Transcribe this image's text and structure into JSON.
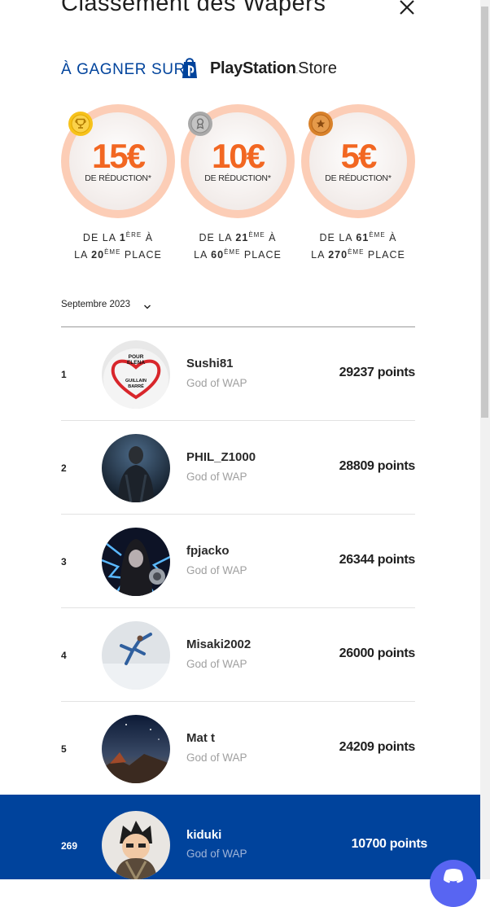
{
  "header": {
    "title": "Classement des Wapers",
    "close_icon": "close-icon"
  },
  "prizes": {
    "heading": "À GAGNER SUR",
    "store_brand": "PlayStation",
    "store_word": "Store",
    "logo_icon": "playstation-logo-icon",
    "items": [
      {
        "amount": "15€",
        "label": "DE RÉDUCTION*",
        "line1_pre": "DE LA ",
        "line1_num": "1",
        "line1_sup": "ÈRE",
        "line1_post": " À",
        "line2_pre": "LA ",
        "line2_num": "20",
        "line2_sup": "ÈME",
        "line2_post": " PLACE",
        "medal": "gold-trophy-icon",
        "medal_color": "#f7c21b"
      },
      {
        "amount": "10€",
        "label": "DE RÉDUCTION*",
        "line1_pre": "DE LA ",
        "line1_num": "21",
        "line1_sup": "ÈME",
        "line1_post": " À",
        "line2_pre": "LA ",
        "line2_num": "60",
        "line2_sup": "ÈME",
        "line2_post": " PLACE",
        "medal": "silver-medal-icon",
        "medal_color": "#a9a9a9"
      },
      {
        "amount": "5€",
        "label": "DE RÉDUCTION*",
        "line1_pre": "DE LA ",
        "line1_num": "61",
        "line1_sup": "ÈME",
        "line1_post": " À",
        "line2_pre": "LA ",
        "line2_num": "270",
        "line2_sup": "ÈME",
        "line2_post": " PLACE",
        "medal": "bronze-star-icon",
        "medal_color": "#d9822b"
      }
    ]
  },
  "filter": {
    "month": "Septembre 2023",
    "icon": "chevron-down-icon"
  },
  "leaderboard": [
    {
      "rank": "1",
      "name": "Sushi81",
      "level": "God of WAP",
      "points": "29237 points"
    },
    {
      "rank": "2",
      "name": "PHIL_Z1000",
      "level": "God of WAP",
      "points": "28809 points"
    },
    {
      "rank": "3",
      "name": "fpjacko",
      "level": "God of WAP",
      "points": "26344 points"
    },
    {
      "rank": "4",
      "name": "Misaki2002",
      "level": "God of WAP",
      "points": "26000 points"
    },
    {
      "rank": "5",
      "name": "Mat t",
      "level": "God of WAP",
      "points": "24209 points"
    }
  ],
  "current_user": {
    "rank": "269",
    "name": "kiduki",
    "level": "God of WAP",
    "points": "10700 points"
  },
  "avatar_art": {
    "sushi81": [
      "POUR",
      "ELENA",
      "GUILLAIN",
      "BARRÉ"
    ]
  },
  "chat": {
    "icon": "discord-chat-icon",
    "color": "#5865f2"
  },
  "colors": {
    "accent": "#00439c",
    "prize_orange": "#f26722",
    "prize_ring": "#fccdb6"
  }
}
